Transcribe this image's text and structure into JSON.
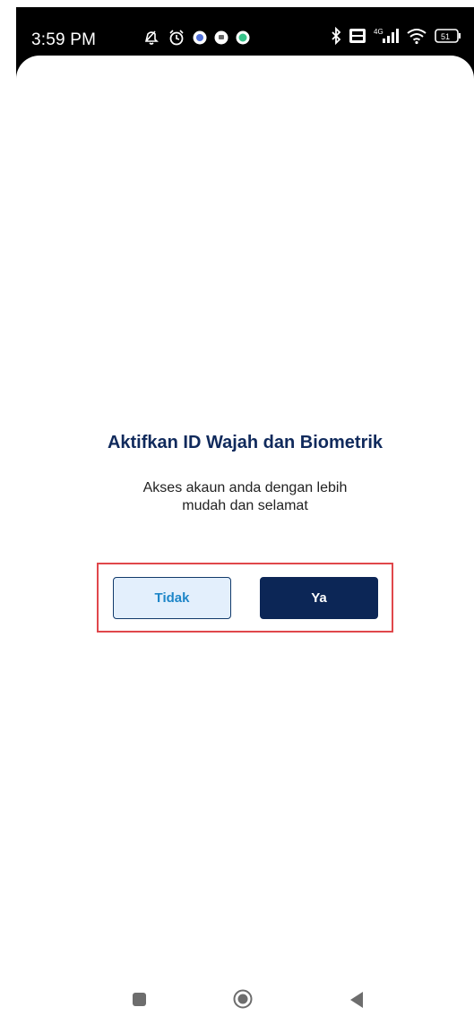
{
  "status_bar": {
    "time": "3:59 PM",
    "battery": "51",
    "network": "4G"
  },
  "dialog": {
    "title": "Aktifkan ID Wajah dan Biometrik",
    "subtitle_line1": "Akses akaun anda dengan lebih",
    "subtitle_line2": "mudah dan selamat",
    "no_label": "Tidak",
    "yes_label": "Ya"
  },
  "colors": {
    "title": "#102a5c",
    "primary_button": "#0c2656",
    "secondary_button_bg": "#e3effc",
    "secondary_button_text": "#1e86c8",
    "highlight_border": "#e0474b"
  },
  "nav_bar": {
    "icons": [
      "recent-apps-icon",
      "home-icon",
      "back-icon"
    ]
  }
}
